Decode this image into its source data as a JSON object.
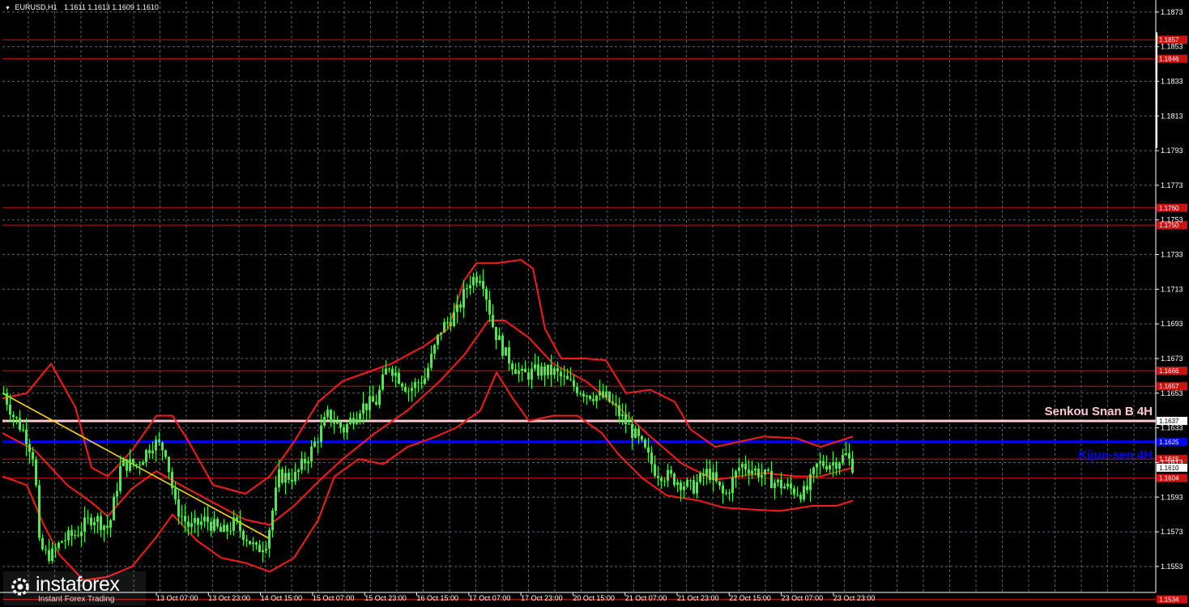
{
  "header": {
    "symbol": "EURUSD,H1",
    "ohlc": "1.1611 1.1613 1.1609 1.1610"
  },
  "watermark": {
    "brand": "instaforex",
    "sub": "Instant Forex Trading"
  },
  "colors": {
    "background": "#000000",
    "grid": "#5a6470",
    "candle": "#33ff33",
    "bands": "#ff1a1a",
    "levels": "#cc1111",
    "kijun": "#0000ff",
    "senkou": "#ffc8d2",
    "trendline": "#ffd700",
    "axis_text": "#ffffff"
  },
  "chart_data": {
    "type": "candlestick",
    "symbol": "EURUSD",
    "timeframe": "H1",
    "grid": true,
    "ylim": [
      1.1538,
      1.1879
    ],
    "y_ticks": [
      "1.1873",
      "1.1853",
      "1.1833",
      "1.1813",
      "1.1793",
      "1.1773",
      "1.1753",
      "1.1733",
      "1.1713",
      "1.1693",
      "1.1673",
      "1.1653",
      "1.1633",
      "1.1613",
      "1.1593",
      "1.1573",
      "1.1553"
    ],
    "x_ticks": [
      "13 Oct 07:00",
      "13 Oct 23:00",
      "14 Oct 15:00",
      "15 Oct 07:00",
      "15 Oct 23:00",
      "16 Oct 15:00",
      "17 Oct 07:00",
      "17 Oct 23:00",
      "20 Oct 15:00",
      "21 Oct 07:00",
      "21 Oct 23:00",
      "22 Oct 15:00",
      "23 Oct 07:00",
      "23 Oct 23:00"
    ],
    "price_path": [
      [
        0,
        1.1653
      ],
      [
        12,
        1.164
      ],
      [
        26,
        1.163
      ],
      [
        38,
        1.1615
      ],
      [
        44,
        1.1565
      ],
      [
        52,
        1.156
      ],
      [
        60,
        1.156
      ],
      [
        72,
        1.1568
      ],
      [
        90,
        1.1572
      ],
      [
        110,
        1.1582
      ],
      [
        130,
        1.1575
      ],
      [
        145,
        1.1612
      ],
      [
        165,
        1.1612
      ],
      [
        185,
        1.1625
      ],
      [
        200,
        1.162
      ],
      [
        212,
        1.1588
      ],
      [
        230,
        1.1575
      ],
      [
        250,
        1.158
      ],
      [
        270,
        1.1572
      ],
      [
        285,
        1.1578
      ],
      [
        300,
        1.157
      ],
      [
        312,
        1.1562
      ],
      [
        325,
        1.1568
      ],
      [
        340,
        1.1605
      ],
      [
        360,
        1.1605
      ],
      [
        380,
        1.162
      ],
      [
        400,
        1.164
      ],
      [
        420,
        1.1632
      ],
      [
        440,
        1.1645
      ],
      [
        460,
        1.1648
      ],
      [
        475,
        1.167
      ],
      [
        500,
        1.1655
      ],
      [
        520,
        1.1662
      ],
      [
        540,
        1.169
      ],
      [
        560,
        1.17
      ],
      [
        575,
        1.1718
      ],
      [
        590,
        1.1722
      ],
      [
        605,
        1.169
      ],
      [
        620,
        1.1675
      ],
      [
        640,
        1.1663
      ],
      [
        660,
        1.1666
      ],
      [
        680,
        1.1665
      ],
      [
        700,
        1.1658
      ],
      [
        720,
        1.1653
      ],
      [
        745,
        1.165
      ],
      [
        765,
        1.1638
      ],
      [
        785,
        1.1625
      ],
      [
        805,
        1.1608
      ],
      [
        830,
        1.1603
      ],
      [
        850,
        1.1598
      ],
      [
        870,
        1.1608
      ],
      [
        890,
        1.1593
      ],
      [
        910,
        1.1612
      ],
      [
        930,
        1.1608
      ],
      [
        950,
        1.1602
      ],
      [
        970,
        1.1598
      ],
      [
        990,
        1.1595
      ],
      [
        1005,
        1.1612
      ],
      [
        1025,
        1.1613
      ],
      [
        1040,
        1.1617
      ],
      [
        1050,
        1.161
      ]
    ],
    "bollinger": {
      "upper": [
        [
          0,
          1.165
        ],
        [
          30,
          1.1653
        ],
        [
          60,
          1.167
        ],
        [
          90,
          1.1645
        ],
        [
          110,
          1.161
        ],
        [
          130,
          1.1605
        ],
        [
          160,
          1.162
        ],
        [
          190,
          1.164
        ],
        [
          210,
          1.164
        ],
        [
          230,
          1.1625
        ],
        [
          260,
          1.16
        ],
        [
          300,
          1.1595
        ],
        [
          330,
          1.1605
        ],
        [
          360,
          1.1625
        ],
        [
          390,
          1.1648
        ],
        [
          420,
          1.166
        ],
        [
          450,
          1.1665
        ],
        [
          480,
          1.167
        ],
        [
          520,
          1.168
        ],
        [
          550,
          1.169
        ],
        [
          570,
          1.1718
        ],
        [
          585,
          1.1728
        ],
        [
          610,
          1.1728
        ],
        [
          640,
          1.173
        ],
        [
          655,
          1.1725
        ],
        [
          670,
          1.169
        ],
        [
          690,
          1.1673
        ],
        [
          720,
          1.1673
        ],
        [
          745,
          1.1672
        ],
        [
          770,
          1.1653
        ],
        [
          800,
          1.1655
        ],
        [
          830,
          1.1648
        ],
        [
          850,
          1.1632
        ],
        [
          880,
          1.1622
        ],
        [
          910,
          1.1625
        ],
        [
          940,
          1.1628
        ],
        [
          980,
          1.1627
        ],
        [
          1010,
          1.1622
        ],
        [
          1030,
          1.1625
        ],
        [
          1050,
          1.1628
        ]
      ],
      "middle": [
        [
          0,
          1.163
        ],
        [
          40,
          1.162
        ],
        [
          80,
          1.16
        ],
        [
          110,
          1.159
        ],
        [
          130,
          1.1582
        ],
        [
          160,
          1.1598
        ],
        [
          190,
          1.1608
        ],
        [
          220,
          1.16
        ],
        [
          260,
          1.159
        ],
        [
          300,
          1.158
        ],
        [
          330,
          1.1577
        ],
        [
          360,
          1.1588
        ],
        [
          390,
          1.1602
        ],
        [
          420,
          1.1615
        ],
        [
          460,
          1.163
        ],
        [
          500,
          1.1643
        ],
        [
          540,
          1.166
        ],
        [
          570,
          1.1675
        ],
        [
          600,
          1.1695
        ],
        [
          620,
          1.1695
        ],
        [
          650,
          1.1685
        ],
        [
          680,
          1.167
        ],
        [
          720,
          1.166
        ],
        [
          760,
          1.1645
        ],
        [
          800,
          1.1628
        ],
        [
          840,
          1.1612
        ],
        [
          880,
          1.1603
        ],
        [
          910,
          1.1605
        ],
        [
          940,
          1.1607
        ],
        [
          980,
          1.1605
        ],
        [
          1010,
          1.1605
        ],
        [
          1050,
          1.161
        ]
      ],
      "lower": [
        [
          0,
          1.1605
        ],
        [
          30,
          1.16
        ],
        [
          50,
          1.1578
        ],
        [
          70,
          1.156
        ],
        [
          100,
          1.1545
        ],
        [
          130,
          1.1547
        ],
        [
          160,
          1.1553
        ],
        [
          190,
          1.157
        ],
        [
          210,
          1.1583
        ],
        [
          240,
          1.1568
        ],
        [
          270,
          1.1558
        ],
        [
          300,
          1.1555
        ],
        [
          330,
          1.155
        ],
        [
          360,
          1.1558
        ],
        [
          390,
          1.158
        ],
        [
          410,
          1.1605
        ],
        [
          440,
          1.1615
        ],
        [
          470,
          1.1612
        ],
        [
          500,
          1.1622
        ],
        [
          530,
          1.1627
        ],
        [
          560,
          1.1633
        ],
        [
          590,
          1.1643
        ],
        [
          610,
          1.1665
        ],
        [
          630,
          1.165
        ],
        [
          650,
          1.1637
        ],
        [
          680,
          1.164
        ],
        [
          710,
          1.164
        ],
        [
          740,
          1.163
        ],
        [
          760,
          1.1618
        ],
        [
          790,
          1.1604
        ],
        [
          820,
          1.1594
        ],
        [
          860,
          1.1591
        ],
        [
          890,
          1.1587
        ],
        [
          920,
          1.1586
        ],
        [
          960,
          1.1585
        ],
        [
          1000,
          1.1588
        ],
        [
          1030,
          1.1588
        ],
        [
          1050,
          1.1591
        ]
      ]
    },
    "trendline": [
      [
        0,
        1.1653
      ],
      [
        330,
        1.1569
      ]
    ],
    "horizontal_levels": [
      {
        "label": "1.1857",
        "value": 1.1857,
        "style": "red"
      },
      {
        "label": "1.1846",
        "value": 1.1846,
        "style": "red"
      },
      {
        "label": "1.1760",
        "value": 1.176,
        "style": "red"
      },
      {
        "label": "1.1750",
        "value": 1.175,
        "style": "red"
      },
      {
        "label": "1.1666",
        "value": 1.1666,
        "style": "red"
      },
      {
        "label": "1.1657",
        "value": 1.1657,
        "style": "red"
      },
      {
        "label": "1.1637",
        "value": 1.1637,
        "style": "senkou"
      },
      {
        "label": "1.1625",
        "value": 1.1625,
        "style": "kijun"
      },
      {
        "label": "1.1615",
        "value": 1.1615,
        "style": "red"
      },
      {
        "label": "1.1604",
        "value": 1.1604,
        "style": "red"
      },
      {
        "label": "1.1534",
        "value": 1.1534,
        "style": "red"
      }
    ],
    "current_price": {
      "label": "1.1610",
      "value": 1.161
    },
    "annotations": [
      {
        "text": "Senkou Snan B 4H",
        "level": 1.1637,
        "color": "senkou"
      },
      {
        "text": "Kijun-sen 4H",
        "level": 1.1625,
        "color": "kijun"
      }
    ]
  }
}
